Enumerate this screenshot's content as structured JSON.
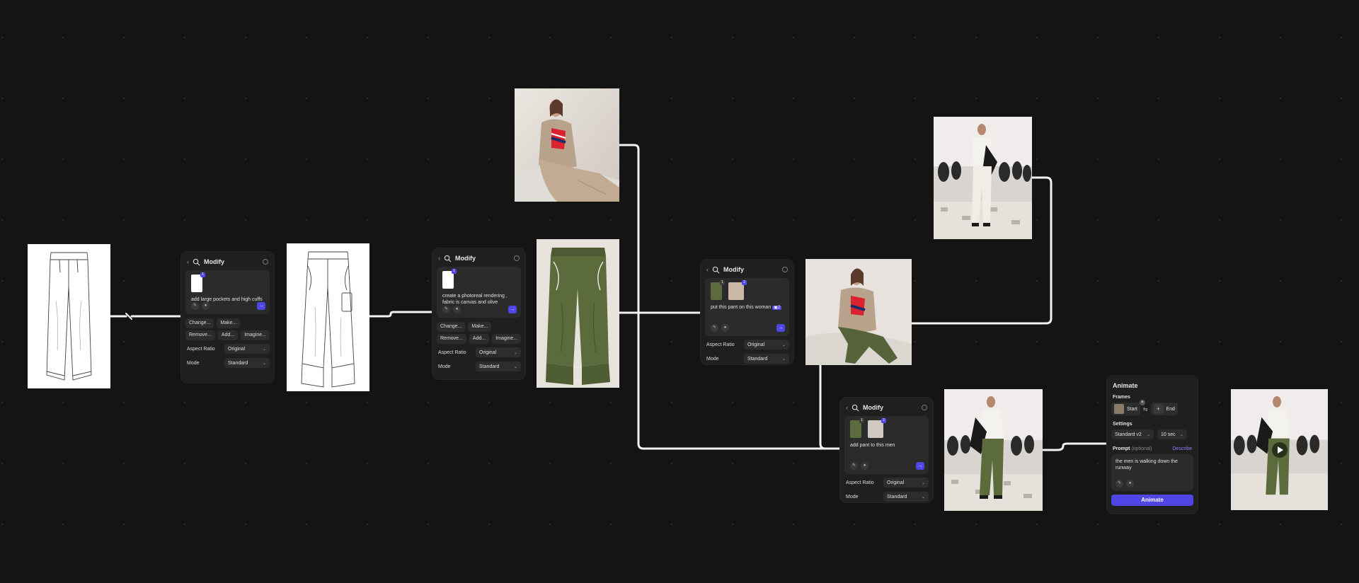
{
  "colors": {
    "canvas": "#141414",
    "panel": "#1f1f1f",
    "accent": "#4f46e5",
    "link": "#8b84ff"
  },
  "modify1": {
    "title": "Modify",
    "badge": "1",
    "prompt": "add large pockets and high cuffs",
    "chips": [
      "Change...",
      "Make...",
      "Remove...",
      "Add...",
      "Imagine..."
    ],
    "aspect_label": "Aspect Ratio",
    "aspect_value": "Original",
    "mode_label": "Mode",
    "mode_value": "Standard"
  },
  "modify2": {
    "title": "Modify",
    "badge": "1",
    "prompt": "create a photoreal rendering , fabric is canvas and olive",
    "chips": [
      "Change...",
      "Make...",
      "Remove...",
      "Add...",
      "Imagine..."
    ],
    "aspect_label": "Aspect Ratio",
    "aspect_value": "Original",
    "mode_label": "Mode",
    "mode_value": "Standard"
  },
  "modify3": {
    "title": "Modify",
    "badges": [
      "1",
      "2"
    ],
    "prompt": "put this pant on this woman",
    "tag": "2",
    "aspect_label": "Aspect Ratio",
    "aspect_value": "Original",
    "mode_label": "Mode",
    "mode_value": "Standard"
  },
  "modify4": {
    "title": "Modify",
    "badges": [
      "1",
      "2"
    ],
    "prompt": "add pant to this men",
    "aspect_label": "Aspect Ratio",
    "aspect_value": "Original",
    "mode_label": "Mode",
    "mode_value": "Standard"
  },
  "animate": {
    "title": "Animate",
    "frames_label": "Frames",
    "start_label": "Start",
    "end_label": "End",
    "settings_label": "Settings",
    "model_value": "Standard v2",
    "duration_value": "10 sec",
    "prompt_label": "Prompt",
    "prompt_optional": "(optional)",
    "describe_label": "Describe",
    "prompt_text": "the men is walking down the runway",
    "button_label": "Animate"
  },
  "icons": [
    "chevron-left-icon",
    "modify-icon",
    "info-icon",
    "brush-icon",
    "mic-icon",
    "send-arrow-icon",
    "swap-icon",
    "plus-icon",
    "play-icon"
  ]
}
